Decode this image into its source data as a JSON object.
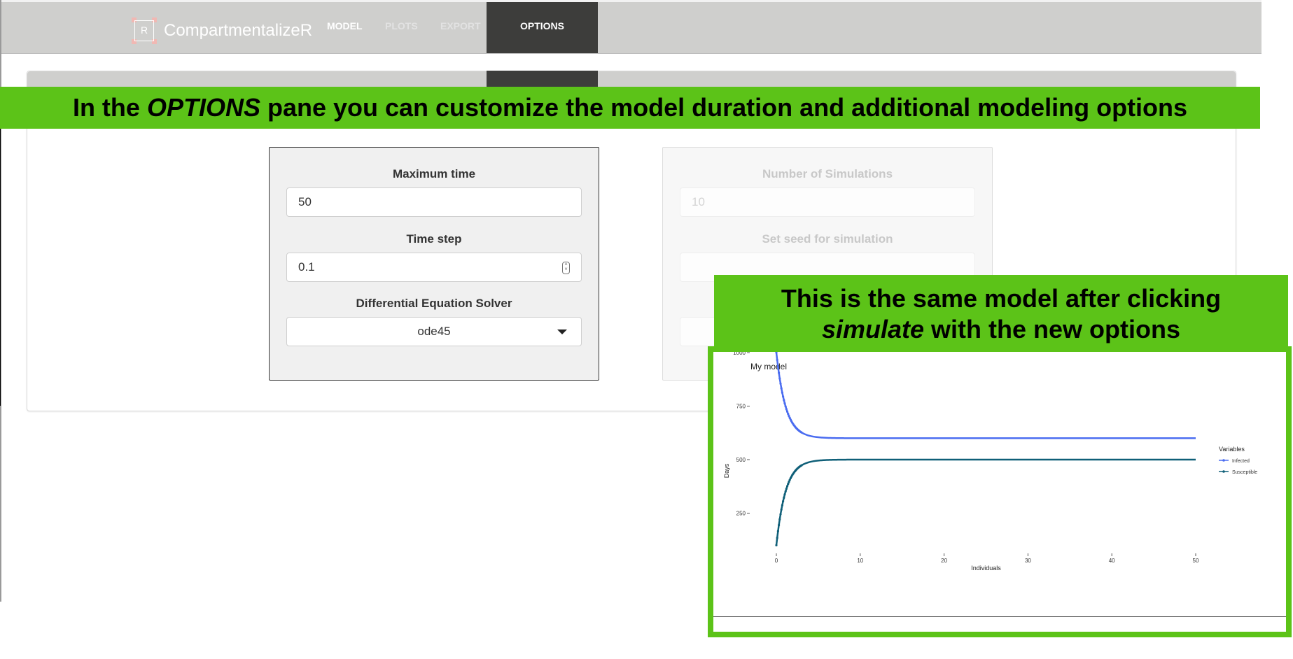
{
  "app": {
    "logo_letter": "R",
    "brand": "CompartmentalizeR",
    "tabs": [
      {
        "label": "MODEL"
      },
      {
        "label": "PLOTS"
      },
      {
        "label": "EXPORT"
      },
      {
        "label": "OPTIONS",
        "active": true
      }
    ]
  },
  "options": {
    "max_time_label": "Maximum time",
    "max_time_value": "50",
    "time_step_label": "Time step",
    "time_step_value": "0.1",
    "solver_label": "Differential Equation Solver",
    "solver_value": "ode45",
    "num_sims_label": "Number of Simulations",
    "num_sims_placeholder": "10",
    "seed_label": "Set seed for simulation"
  },
  "annotations": {
    "top_pre": "In the ",
    "top_em": "OPTIONS",
    "top_post": " pane you can customize the model duration and additional modeling options",
    "right_line1": "This is the same model after clicking",
    "right_em": "simulate",
    "right_line2_post": " with the new options"
  },
  "colors": {
    "banner_green": "#5cc318",
    "navbar_gray": "#cfcfcd",
    "active_tab": "#3d3d3b",
    "infected": "#4a6cf0",
    "susceptible": "#0f5f78"
  },
  "chart_data": {
    "type": "line",
    "title": "My model",
    "xlabel": "Individuals",
    "ylabel": "Days",
    "xlim": [
      0,
      50
    ],
    "ylim": [
      0,
      1000
    ],
    "x_ticks": [
      0,
      10,
      20,
      30,
      40,
      50
    ],
    "y_ticks": [
      250,
      500,
      750,
      1000
    ],
    "legend_title": "Variables",
    "legend_position": "right",
    "series": [
      {
        "name": "Infected",
        "color": "#4a6cf0",
        "start": 1000,
        "plateau": 600,
        "rate": 0.9
      },
      {
        "name": "Susceptible",
        "color": "#0f5f78",
        "start": 100,
        "plateau": 500,
        "rate": 0.9
      }
    ]
  }
}
